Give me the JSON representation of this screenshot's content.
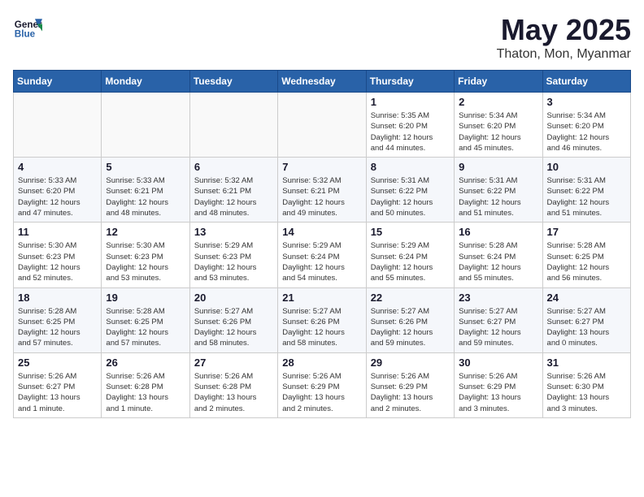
{
  "header": {
    "logo_line1": "General",
    "logo_line2": "Blue",
    "month": "May 2025",
    "location": "Thaton, Mon, Myanmar"
  },
  "weekdays": [
    "Sunday",
    "Monday",
    "Tuesday",
    "Wednesday",
    "Thursday",
    "Friday",
    "Saturday"
  ],
  "weeks": [
    [
      {
        "day": "",
        "info": ""
      },
      {
        "day": "",
        "info": ""
      },
      {
        "day": "",
        "info": ""
      },
      {
        "day": "",
        "info": ""
      },
      {
        "day": "1",
        "info": "Sunrise: 5:35 AM\nSunset: 6:20 PM\nDaylight: 12 hours\nand 44 minutes."
      },
      {
        "day": "2",
        "info": "Sunrise: 5:34 AM\nSunset: 6:20 PM\nDaylight: 12 hours\nand 45 minutes."
      },
      {
        "day": "3",
        "info": "Sunrise: 5:34 AM\nSunset: 6:20 PM\nDaylight: 12 hours\nand 46 minutes."
      }
    ],
    [
      {
        "day": "4",
        "info": "Sunrise: 5:33 AM\nSunset: 6:20 PM\nDaylight: 12 hours\nand 47 minutes."
      },
      {
        "day": "5",
        "info": "Sunrise: 5:33 AM\nSunset: 6:21 PM\nDaylight: 12 hours\nand 48 minutes."
      },
      {
        "day": "6",
        "info": "Sunrise: 5:32 AM\nSunset: 6:21 PM\nDaylight: 12 hours\nand 48 minutes."
      },
      {
        "day": "7",
        "info": "Sunrise: 5:32 AM\nSunset: 6:21 PM\nDaylight: 12 hours\nand 49 minutes."
      },
      {
        "day": "8",
        "info": "Sunrise: 5:31 AM\nSunset: 6:22 PM\nDaylight: 12 hours\nand 50 minutes."
      },
      {
        "day": "9",
        "info": "Sunrise: 5:31 AM\nSunset: 6:22 PM\nDaylight: 12 hours\nand 51 minutes."
      },
      {
        "day": "10",
        "info": "Sunrise: 5:31 AM\nSunset: 6:22 PM\nDaylight: 12 hours\nand 51 minutes."
      }
    ],
    [
      {
        "day": "11",
        "info": "Sunrise: 5:30 AM\nSunset: 6:23 PM\nDaylight: 12 hours\nand 52 minutes."
      },
      {
        "day": "12",
        "info": "Sunrise: 5:30 AM\nSunset: 6:23 PM\nDaylight: 12 hours\nand 53 minutes."
      },
      {
        "day": "13",
        "info": "Sunrise: 5:29 AM\nSunset: 6:23 PM\nDaylight: 12 hours\nand 53 minutes."
      },
      {
        "day": "14",
        "info": "Sunrise: 5:29 AM\nSunset: 6:24 PM\nDaylight: 12 hours\nand 54 minutes."
      },
      {
        "day": "15",
        "info": "Sunrise: 5:29 AM\nSunset: 6:24 PM\nDaylight: 12 hours\nand 55 minutes."
      },
      {
        "day": "16",
        "info": "Sunrise: 5:28 AM\nSunset: 6:24 PM\nDaylight: 12 hours\nand 55 minutes."
      },
      {
        "day": "17",
        "info": "Sunrise: 5:28 AM\nSunset: 6:25 PM\nDaylight: 12 hours\nand 56 minutes."
      }
    ],
    [
      {
        "day": "18",
        "info": "Sunrise: 5:28 AM\nSunset: 6:25 PM\nDaylight: 12 hours\nand 57 minutes."
      },
      {
        "day": "19",
        "info": "Sunrise: 5:28 AM\nSunset: 6:25 PM\nDaylight: 12 hours\nand 57 minutes."
      },
      {
        "day": "20",
        "info": "Sunrise: 5:27 AM\nSunset: 6:26 PM\nDaylight: 12 hours\nand 58 minutes."
      },
      {
        "day": "21",
        "info": "Sunrise: 5:27 AM\nSunset: 6:26 PM\nDaylight: 12 hours\nand 58 minutes."
      },
      {
        "day": "22",
        "info": "Sunrise: 5:27 AM\nSunset: 6:26 PM\nDaylight: 12 hours\nand 59 minutes."
      },
      {
        "day": "23",
        "info": "Sunrise: 5:27 AM\nSunset: 6:27 PM\nDaylight: 12 hours\nand 59 minutes."
      },
      {
        "day": "24",
        "info": "Sunrise: 5:27 AM\nSunset: 6:27 PM\nDaylight: 13 hours\nand 0 minutes."
      }
    ],
    [
      {
        "day": "25",
        "info": "Sunrise: 5:26 AM\nSunset: 6:27 PM\nDaylight: 13 hours\nand 1 minute."
      },
      {
        "day": "26",
        "info": "Sunrise: 5:26 AM\nSunset: 6:28 PM\nDaylight: 13 hours\nand 1 minute."
      },
      {
        "day": "27",
        "info": "Sunrise: 5:26 AM\nSunset: 6:28 PM\nDaylight: 13 hours\nand 2 minutes."
      },
      {
        "day": "28",
        "info": "Sunrise: 5:26 AM\nSunset: 6:29 PM\nDaylight: 13 hours\nand 2 minutes."
      },
      {
        "day": "29",
        "info": "Sunrise: 5:26 AM\nSunset: 6:29 PM\nDaylight: 13 hours\nand 2 minutes."
      },
      {
        "day": "30",
        "info": "Sunrise: 5:26 AM\nSunset: 6:29 PM\nDaylight: 13 hours\nand 3 minutes."
      },
      {
        "day": "31",
        "info": "Sunrise: 5:26 AM\nSunset: 6:30 PM\nDaylight: 13 hours\nand 3 minutes."
      }
    ]
  ]
}
